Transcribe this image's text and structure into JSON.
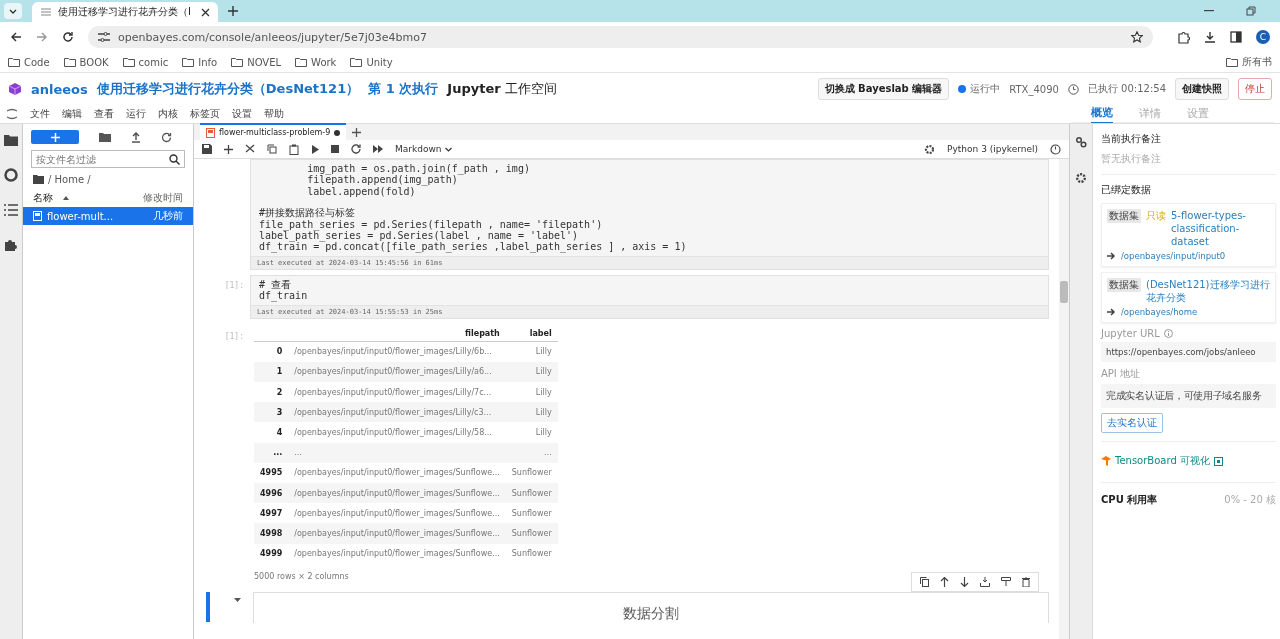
{
  "browser": {
    "tab_title": "使用迁移学习进行花卉分类（I",
    "url": "openbayes.com/console/anleeos/jupyter/5e7j03e4bmo7",
    "avatar": "C",
    "bookmarks": [
      "Code",
      "BOOK",
      "comic",
      "Info",
      "NOVEL",
      "Work",
      "Unity"
    ],
    "other_bookmarks": "所有书"
  },
  "header": {
    "user": "anleeos",
    "project": "使用迁移学习进行花卉分类（DesNet121）",
    "run": "第 1 次执行",
    "workspace_bold": "Jupyter",
    "workspace": "工作空间",
    "switch_button": "切换成 Bayeslab 编辑器",
    "status": "运行中",
    "gpu": "RTX_4090",
    "elapsed": "已执行 00:12:54",
    "snapshot_button": "创建快照",
    "stop_button": "停止"
  },
  "menu": [
    "文件",
    "编辑",
    "查看",
    "运行",
    "内核",
    "标签页",
    "设置",
    "帮助"
  ],
  "file_browser": {
    "filter_placeholder": "按文件名过滤",
    "path": "/ Home /",
    "col_name": "名称",
    "col_modified": "修改时间",
    "files": [
      {
        "name": "flower-mult...",
        "modified": "几秒前",
        "selected": true
      }
    ]
  },
  "notebook": {
    "tab": "flower-multiclass-problem-9",
    "cell_type": "Markdown",
    "kernel": "Python 3 (ipykernel)",
    "cells": [
      {
        "kind": "code",
        "blocks": [
          [
            "        img_path = os.path.join(f_path , img)",
            "        filepath.append(img_path)",
            "        label.append(fold)"
          ],
          [
            "#拼接数据路径与标签",
            "file_path_series = pd.Series(filepath , name= 'filepath')",
            "label_path_series = pd.Series(label , name = 'label')",
            "df_train = pd.concat([file_path_series ,label_path_series ] , axis = 1)"
          ]
        ],
        "footer": "Last executed at 2024-03-14 15:45:56 in 61ms"
      },
      {
        "kind": "code",
        "prompt": "[1]:",
        "blocks": [
          [
            "# 查看",
            "df_train"
          ]
        ],
        "footer": "Last executed at 2024-03-14 15:55:53 in 25ms"
      }
    ],
    "output": {
      "prompt": "[1]:",
      "columns": [
        "",
        "filepath",
        "label"
      ],
      "rows": [
        [
          "0",
          "/openbayes/input/input0/flower_images/Lilly/6b...",
          "Lilly"
        ],
        [
          "1",
          "/openbayes/input/input0/flower_images/Lilly/a6...",
          "Lilly"
        ],
        [
          "2",
          "/openbayes/input/input0/flower_images/Lilly/7c...",
          "Lilly"
        ],
        [
          "3",
          "/openbayes/input/input0/flower_images/Lilly/c3...",
          "Lilly"
        ],
        [
          "4",
          "/openbayes/input/input0/flower_images/Lilly/58...",
          "Lilly"
        ],
        [
          "...",
          "...",
          "..."
        ],
        [
          "4995",
          "/openbayes/input/input0/flower_images/Sunflowe...",
          "Sunflower"
        ],
        [
          "4996",
          "/openbayes/input/input0/flower_images/Sunflowe...",
          "Sunflower"
        ],
        [
          "4997",
          "/openbayes/input/input0/flower_images/Sunflowe...",
          "Sunflower"
        ],
        [
          "4998",
          "/openbayes/input/input0/flower_images/Sunflowe...",
          "Sunflower"
        ],
        [
          "4999",
          "/openbayes/input/input0/flower_images/Sunflowe...",
          "Sunflower"
        ]
      ],
      "summary": "5000 rows × 2 columns"
    },
    "markdown_heading": "数据分割"
  },
  "right_panel": {
    "tabs": [
      {
        "label": "概览",
        "selected": true
      },
      {
        "label": "详情",
        "selected": false
      },
      {
        "label": "设置",
        "selected": false
      }
    ],
    "note_title": "当前执行备注",
    "note_empty": "暂无执行备注",
    "data_title": "已绑定数据",
    "datasets": [
      {
        "tag": "数据集",
        "badge": "只读",
        "name": "5-flower-types-classification-dataset",
        "mount": "/openbayes/input/input0"
      },
      {
        "tag": "数据集",
        "name": "(DesNet121)迁移学习进行花卉分类",
        "mount": "/openbayes/home"
      }
    ],
    "jupyter_label": "Jupyter URL",
    "jupyter_url": "https://openbayes.com/jobs/anleeo",
    "api_label": "API 地址",
    "api_value": "完成实名认证后，可使用子域名服务",
    "verify_button": "去实名认证",
    "tensorboard": "TensorBoard 可视化",
    "cpu_label": "CPU 利用率",
    "cpu_range": "0% - 20 核"
  }
}
